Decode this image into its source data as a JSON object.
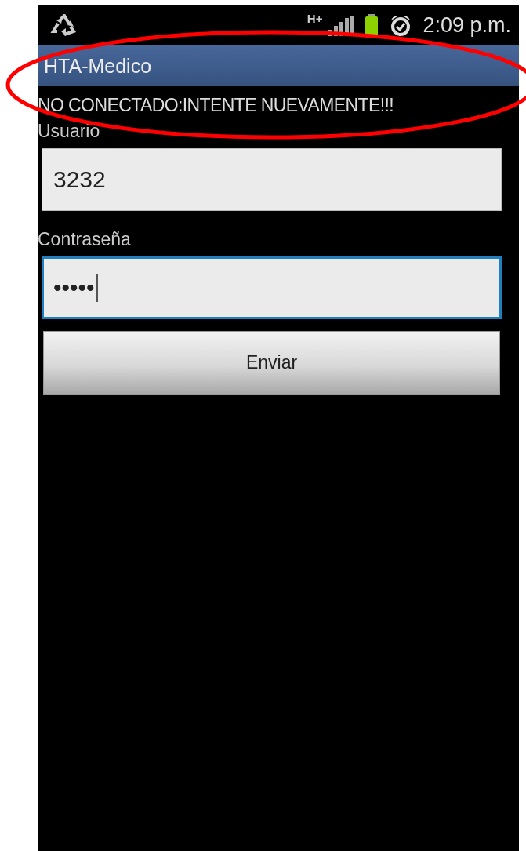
{
  "status_bar": {
    "network": "H+",
    "time": "2:09 p.m."
  },
  "title_bar": {
    "title": "HTA-Medico"
  },
  "message": "NO CONECTADO:INTENTE NUEVAMENTE!!!",
  "fields": [
    {
      "label": "Usuario",
      "value": "3232",
      "focused": false
    },
    {
      "label": "Contraseña",
      "value": "•••••",
      "focused": true
    }
  ],
  "buttons": [
    "Enviar"
  ],
  "annotation": {
    "kind": "ellipse"
  }
}
